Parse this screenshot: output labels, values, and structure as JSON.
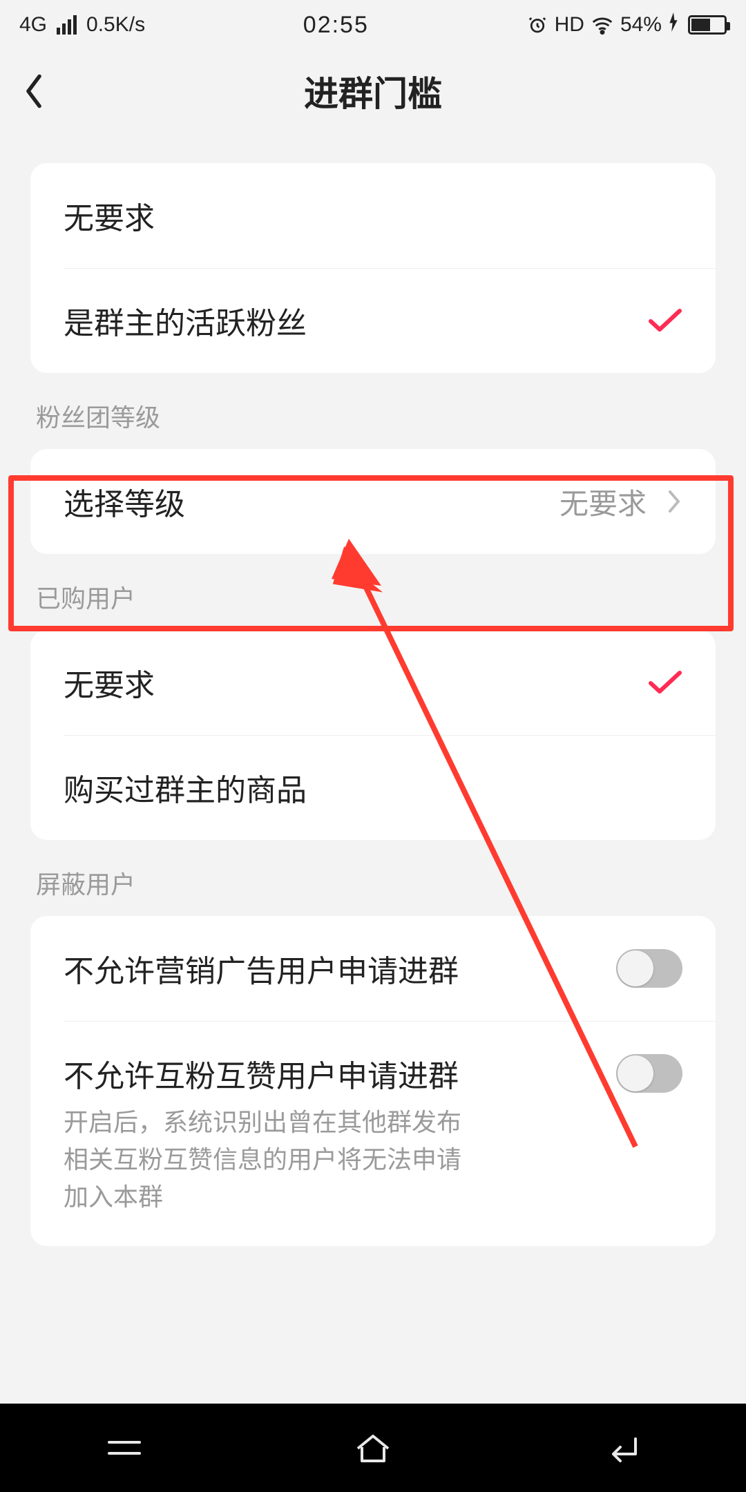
{
  "status": {
    "network": "4G",
    "speed": "0.5K/s",
    "time": "02:55",
    "hd": "HD",
    "battery_pct": "54%"
  },
  "header": {
    "title": "进群门槛"
  },
  "sections": {
    "basic": {
      "no_requirement": "无要求",
      "active_fan": "是群主的活跃粉丝"
    },
    "fan_level": {
      "label": "粉丝团等级",
      "select_label": "选择等级",
      "select_value": "无要求"
    },
    "purchased": {
      "label": "已购用户",
      "no_requirement": "无要求",
      "bought_item": "购买过群主的商品"
    },
    "blocked": {
      "label": "屏蔽用户",
      "block_ads": "不允许营销广告用户申请进群",
      "block_mutual": "不允许互粉互赞用户申请进群",
      "block_mutual_desc": "开启后，系统识别出曾在其他群发布相关互粉互赞信息的用户将无法申请加入本群"
    }
  },
  "colors": {
    "accent": "#fe2c55",
    "annotation": "#ff3b30"
  }
}
